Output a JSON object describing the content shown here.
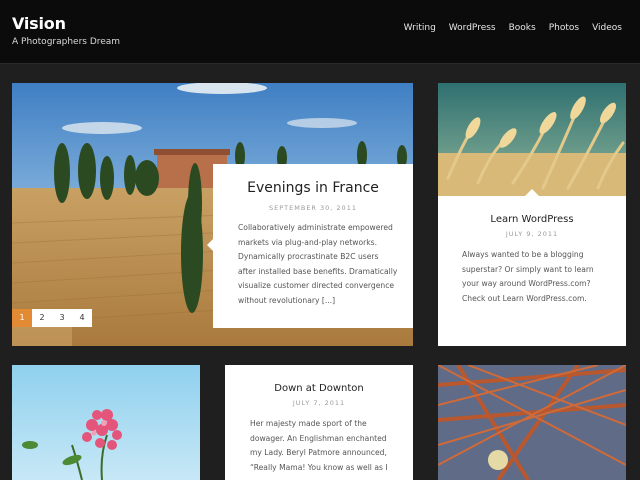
{
  "site": {
    "title": "Vision",
    "description": "A Photographers Dream"
  },
  "nav": [
    "Writing",
    "WordPress",
    "Books",
    "Photos",
    "Videos"
  ],
  "featured": {
    "title": "Evenings in France",
    "date": "SEPTEMBER 30, 2011",
    "excerpt": "Collaboratively administrate empowered markets via plug-and-play networks. Dynamically procrastinate B2C users after installed base benefits. Dramatically visualize customer directed convergence without revolutionary [...]",
    "pages": [
      "1",
      "2",
      "3",
      "4"
    ],
    "active_page": "1"
  },
  "learn_wordpress": {
    "title": "Learn WordPress",
    "date": "JULY 9, 2011",
    "excerpt": "Always wanted to be a blogging superstar? Or simply want to learn your way around WordPress.com? Check out Learn WordPress.com."
  },
  "down_at_downton": {
    "title": "Down at Downton",
    "date": "JULY 7, 2011",
    "excerpt": "Her majesty made sport of the dowager. An Englishman enchanted my Lady. Beryl Patmore announced, “Really Mama! You know as well as I"
  },
  "colors": {
    "header_bg": "#0b0b0b",
    "page_bg": "#1f1f1f",
    "accent": "#e38b34"
  }
}
